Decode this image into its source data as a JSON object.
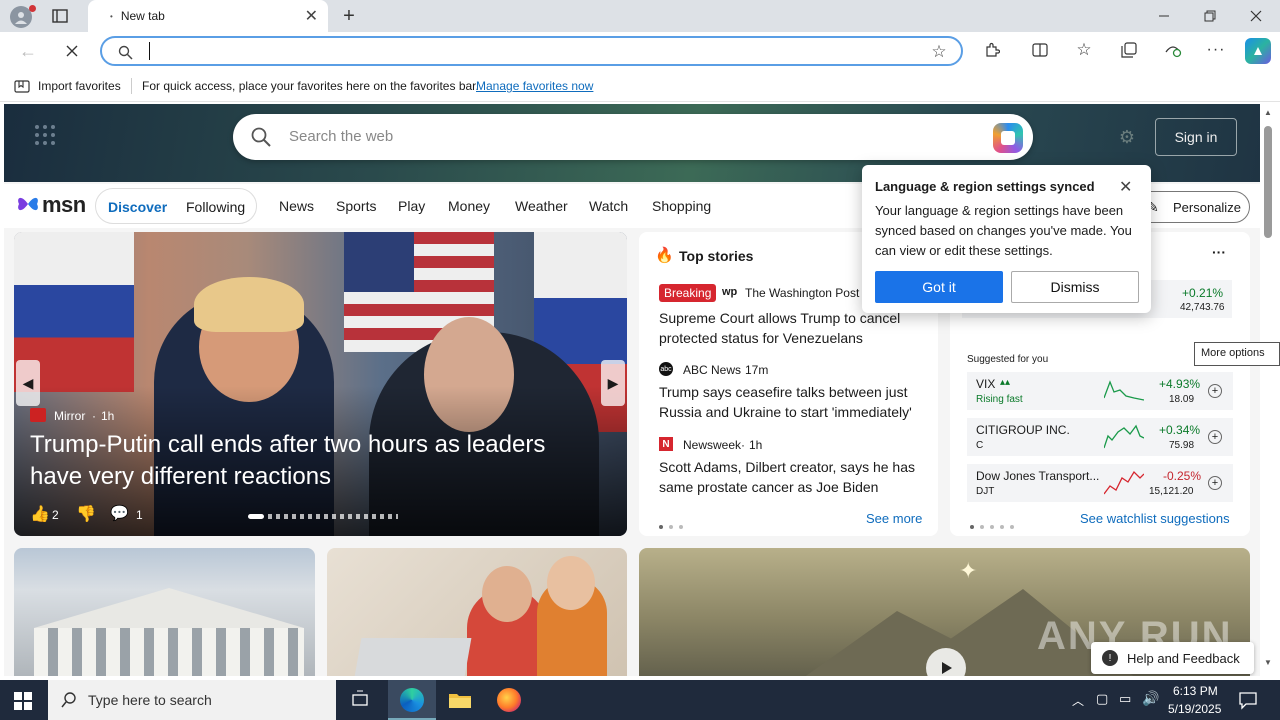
{
  "browser": {
    "tab_title": "New tab",
    "address_value": "",
    "favbar": {
      "import_label": "Import favorites",
      "hint": "For quick access, place your favorites here on the favorites bar.",
      "manage_link": "Manage favorites now"
    }
  },
  "msn": {
    "search_placeholder": "Search the web",
    "sign_in": "Sign in",
    "logo": "msn",
    "tabs": [
      "Discover",
      "Following"
    ],
    "nav": [
      "News",
      "Sports",
      "Play",
      "Money",
      "Weather",
      "Watch",
      "Shopping"
    ],
    "personalize": "Personalize",
    "hero": {
      "source": "Mirror",
      "age": "1h",
      "headline": "Trump-Putin call ends after two hours as leaders have very different reactions",
      "likes": "2",
      "comments": "1"
    },
    "top_stories": {
      "title": "Top stories",
      "items": [
        {
          "badge": "Breaking",
          "source": "The Washington Post",
          "headline": "Supreme Court allows Trump to cancel protected status for Venezuelans"
        },
        {
          "source": "ABC News",
          "age": "17m",
          "headline": "Trump says ceasefire talks between just Russia and Ukraine to start 'immediately'"
        },
        {
          "source": "Newsweek",
          "age": "1h",
          "headline": "Scott Adams, Dilbert creator, says he has same prostate cancer as Joe Biden"
        }
      ],
      "see_more": "See more"
    },
    "watchlist": {
      "top_change": "+0.21%",
      "top_value": "42,743.76",
      "suggested_label": "Suggested for you",
      "more_options_tooltip": "More options",
      "stocks": [
        {
          "name": "VIX",
          "sub": "Rising fast",
          "change": "+4.93%",
          "value": "18.09"
        },
        {
          "name": "CITIGROUP INC.",
          "sub": "C",
          "change": "+0.34%",
          "value": "75.98"
        },
        {
          "name": "Dow Jones Transport...",
          "sub": "DJT",
          "change": "-0.25%",
          "value": "15,121.20"
        }
      ],
      "see_suggestions": "See watchlist suggestions"
    },
    "popup": {
      "title": "Language & region settings synced",
      "body": "Your language & region settings have been synced based on changes you've made. You can view or edit these settings.",
      "got_it": "Got it",
      "dismiss": "Dismiss"
    },
    "feedback": "Help and Feedback",
    "watermark": "ANY RUN"
  },
  "taskbar": {
    "search_placeholder": "Type here to search",
    "time": "6:13 PM",
    "date": "5/19/2025"
  },
  "colors": {
    "accent": "#0f6cbd",
    "popup_btn": "#1a73e8",
    "positive": "#0b7a2a",
    "negative": "#c4262e",
    "breaking": "#d6262f"
  }
}
